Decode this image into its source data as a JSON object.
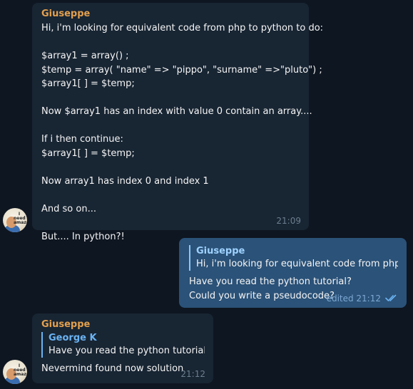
{
  "messages": {
    "m1": {
      "sender": "Giuseppe",
      "lines": [
        "Hi, i'm looking for equivalent code from php to python to do:",
        "",
        "$array1 = array() ;",
        "$temp = array( \"name\" => \"pippo\", \"surname\" =>\"pluto\") ;",
        "$array1[ ] = $temp;",
        "",
        "Now $array1 has an index with value 0 contain an array....",
        "",
        "If i then continue:",
        "$array1[ ] = $temp;",
        "",
        "Now array1 has index 0 and index 1",
        "",
        "And so on...",
        "",
        "But.... In python?!"
      ],
      "time": "21:09"
    },
    "m2": {
      "quote_name": "Giuseppe",
      "quote_text": "Hi, i'm looking for equivalent code from php t...",
      "lines": [
        "Have you read the python tutorial?",
        "Could you write a pseudocode?"
      ],
      "time": "edited 21:12"
    },
    "m3": {
      "sender": "Giuseppe",
      "quote_name": "George K",
      "quote_text": "Have you read the python tutorial...",
      "line": "Nevermind found now solution",
      "time": "21:12"
    }
  },
  "avatar": {
    "badge_text": "I need amazon"
  },
  "colors": {
    "background": "#0e1621",
    "incoming_bubble": "#182533",
    "outgoing_bubble": "#2b5278",
    "sender_name": "#e3a04f",
    "quote_accent": "#6ab3f3",
    "read_check": "#6ab3f3"
  }
}
